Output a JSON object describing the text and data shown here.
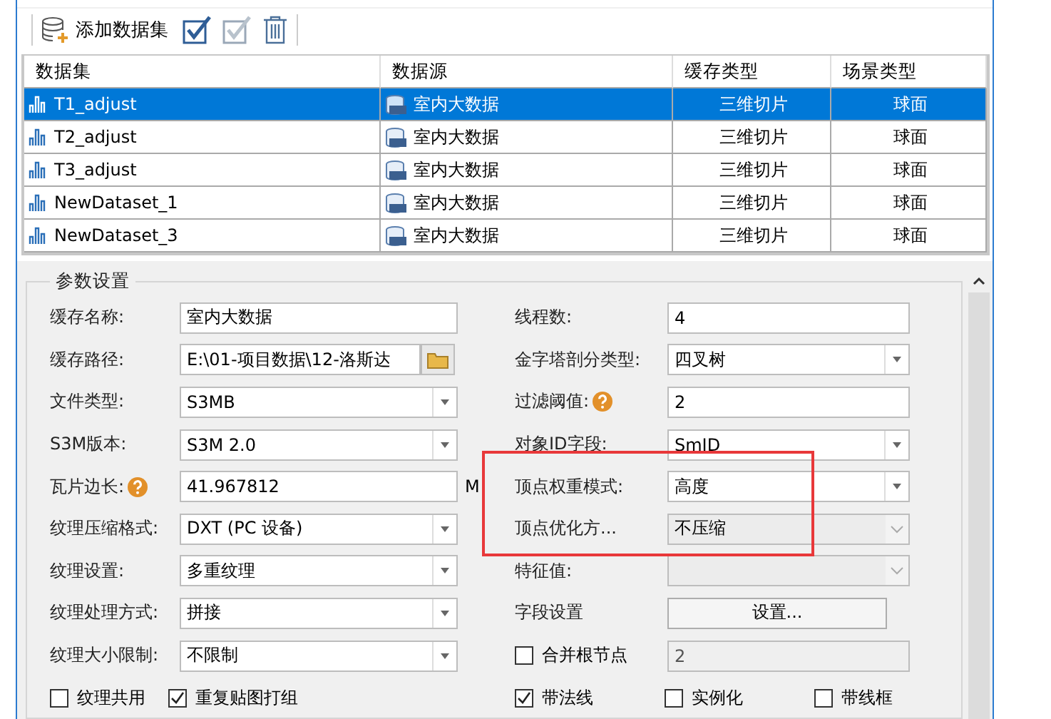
{
  "toolbar": {
    "add_label": "添加数据集"
  },
  "table": {
    "columns": [
      "数据集",
      "数据源",
      "缓存类型",
      "场景类型"
    ],
    "rows": [
      {
        "dataset": "T1_adjust",
        "source": "室内大数据",
        "cache_type": "三维切片",
        "scene_type": "球面",
        "selected": true
      },
      {
        "dataset": "T2_adjust",
        "source": "室内大数据",
        "cache_type": "三维切片",
        "scene_type": "球面",
        "selected": false
      },
      {
        "dataset": "T3_adjust",
        "source": "室内大数据",
        "cache_type": "三维切片",
        "scene_type": "球面",
        "selected": false
      },
      {
        "dataset": "NewDataset_1",
        "source": "室内大数据",
        "cache_type": "三维切片",
        "scene_type": "球面",
        "selected": false
      },
      {
        "dataset": "NewDataset_3",
        "source": "室内大数据",
        "cache_type": "三维切片",
        "scene_type": "球面",
        "selected": false
      }
    ]
  },
  "params": {
    "title": "参数设置",
    "left": [
      {
        "label": "缓存名称:",
        "kind": "text",
        "value": "室内大数据"
      },
      {
        "label": "缓存路径:",
        "kind": "path",
        "value": "E:\\01-项目数据\\12-洛斯达"
      },
      {
        "label": "文件类型:",
        "kind": "select",
        "value": "S3MB"
      },
      {
        "label": "S3M版本:",
        "kind": "select",
        "value": "S3M 2.0"
      },
      {
        "label": "瓦片边长:",
        "kind": "text",
        "help": true,
        "value": "41.967812",
        "unit": "M"
      },
      {
        "label": "纹理压缩格式:",
        "kind": "select",
        "value": "DXT (PC 设备)"
      },
      {
        "label": "纹理设置:",
        "kind": "select",
        "value": "多重纹理"
      },
      {
        "label": "纹理处理方式:",
        "kind": "select",
        "value": "拼接"
      },
      {
        "label": "纹理大小限制:",
        "kind": "select",
        "value": "不限制"
      }
    ],
    "right": [
      {
        "label": "线程数:",
        "kind": "text",
        "value": "4"
      },
      {
        "label": "金字塔剖分类型:",
        "kind": "select",
        "value": "四叉树"
      },
      {
        "label": "过滤阈值:",
        "kind": "text",
        "help": true,
        "value": "2"
      },
      {
        "label": "对象ID字段:",
        "kind": "select",
        "value": "SmID"
      },
      {
        "label": "顶点权重模式:",
        "kind": "select",
        "value": "高度",
        "highlighted": true
      },
      {
        "label": "顶点优化方...",
        "kind": "select",
        "value": "不压缩",
        "disabled": true,
        "highlighted": true
      },
      {
        "label": "特征值:",
        "kind": "select",
        "disabled": true
      },
      {
        "label": "字段设置",
        "kind": "button",
        "value": "设置..."
      },
      {
        "label": "合并根节点",
        "kind": "check",
        "checked": false,
        "value": "2",
        "disabled": true
      }
    ],
    "checks_left": [
      {
        "label": "纹理共用",
        "checked": false
      },
      {
        "label": "重复贴图打组",
        "checked": true
      }
    ],
    "checks_right": [
      {
        "label": "带法线",
        "checked": true
      },
      {
        "label": "实例化",
        "checked": false
      },
      {
        "label": "带线框",
        "checked": false
      }
    ]
  }
}
